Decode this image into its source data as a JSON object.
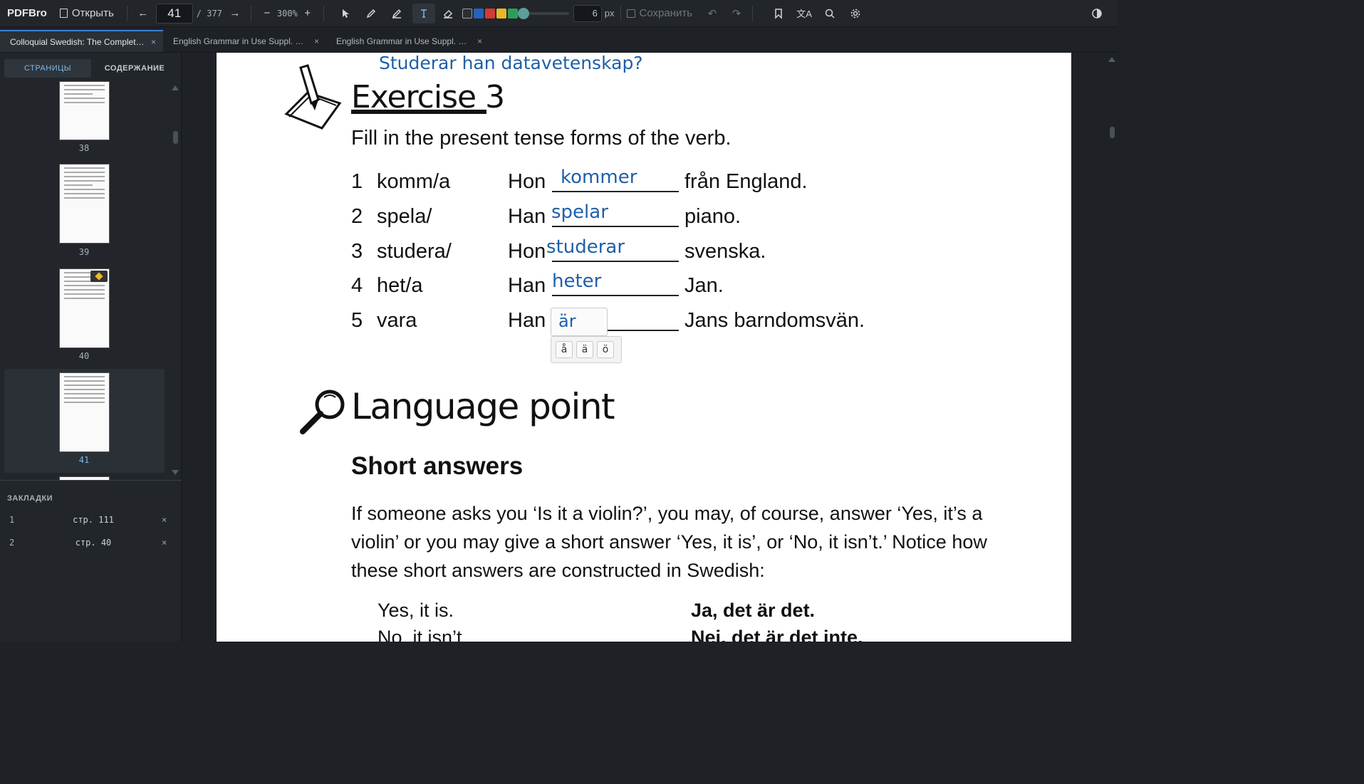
{
  "toolbar": {
    "brand": "PDFBro",
    "open_label": "Открыть",
    "page_current": "41",
    "page_total": "/ 377",
    "zoom": "300%",
    "stroke_size": "6",
    "stroke_unit": "px",
    "save_label": "Сохранить",
    "colors": [
      "#2b2f34",
      "#2563b8",
      "#d33a36",
      "#e7b82b",
      "#2f9d59"
    ]
  },
  "tabs": [
    {
      "label": "Colloquial Swedish: The Complet…",
      "close": "×"
    },
    {
      "label": "English Grammar in Use Suppl. E…",
      "close": "×"
    },
    {
      "label": "English Grammar in Use Suppl. E…",
      "close": "×"
    }
  ],
  "sidebar": {
    "tab_pages": "СТРАНИЦЫ",
    "tab_contents": "СОДЕРЖАНИЕ",
    "thumbnails": [
      {
        "label": "38"
      },
      {
        "label": "39"
      },
      {
        "label": "40"
      },
      {
        "label": "41"
      }
    ],
    "bookmarks_title": "ЗАКЛАДКИ",
    "bookmarks": [
      {
        "num": "1",
        "page": "стр. 111",
        "remove": "×"
      },
      {
        "num": "2",
        "page": "стр. 40",
        "remove": "×"
      }
    ]
  },
  "document": {
    "annotation_top": "Studerar han datavetenskap?",
    "exercise_title": "Exercise 3",
    "instruction": "Fill in the present tense forms of the verb.",
    "rows": [
      {
        "num": "1",
        "verb": "komm/a",
        "subject": "Hon",
        "answer": "kommer",
        "rest": "från England."
      },
      {
        "num": "2",
        "verb": "spela/",
        "subject": "Han",
        "answer": "spelar",
        "rest": "piano."
      },
      {
        "num": "3",
        "verb": "studera/",
        "subject": "Hon",
        "answer": "studerar",
        "rest": "svenska."
      },
      {
        "num": "4",
        "verb": "het/a",
        "subject": "Han",
        "answer": "heter",
        "rest": "Jan."
      },
      {
        "num": "5",
        "verb": "vara",
        "subject": "Han",
        "answer": "är",
        "rest": "Jans barndomsvän."
      }
    ],
    "special_chars": [
      "å",
      "ä",
      "ö"
    ],
    "language_point_title": "Language point",
    "short_answers_title": "Short answers",
    "paragraph": "If someone asks you ‘Is it a violin?’, you may, of course, answer ‘Yes, it’s a violin’ or you may give a short answer ‘Yes, it is’, or ‘No, it isn’t.’ Notice how these short answers are constructed in Swedish:",
    "examples": [
      {
        "en": "Yes, it is.",
        "sv": "Ja, det är det."
      },
      {
        "en": "No, it isn’t.",
        "sv": "Nej, det är det inte."
      }
    ]
  }
}
